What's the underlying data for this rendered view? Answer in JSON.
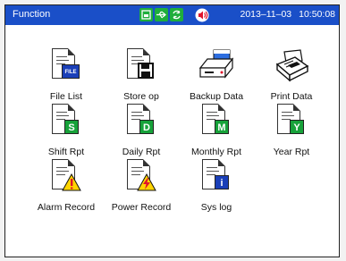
{
  "window": {
    "title": "Function"
  },
  "status_icons": [
    "storage-icon",
    "usb-icon",
    "refresh-icon"
  ],
  "alarm_icon": "alarm-speaker-icon",
  "clock": {
    "date": "2013–11–03",
    "time": "10:50:08"
  },
  "colors": {
    "titlebar": "#1a4fc8",
    "status_green": "#1fae3c",
    "alarm_red": "#e0142c"
  },
  "functions": [
    {
      "label": "File List",
      "icon": "file-list-icon",
      "badge": "FILE"
    },
    {
      "label": "Store op",
      "icon": "save-icon"
    },
    {
      "label": "Backup Data",
      "icon": "backup-drive-icon"
    },
    {
      "label": "Print Data",
      "icon": "printer-icon"
    },
    {
      "label": "Shift Rpt",
      "icon": "shift-report-icon",
      "badge": "S"
    },
    {
      "label": "Daily Rpt",
      "icon": "daily-report-icon",
      "badge": "D"
    },
    {
      "label": "Monthly Rpt",
      "icon": "monthly-report-icon",
      "badge": "M"
    },
    {
      "label": "Year Rpt",
      "icon": "year-report-icon",
      "badge": "Y"
    },
    {
      "label": "Alarm Record",
      "icon": "alarm-record-icon"
    },
    {
      "label": "Power Record",
      "icon": "power-record-icon"
    },
    {
      "label": "Sys log",
      "icon": "system-log-icon",
      "badge": "i"
    }
  ]
}
